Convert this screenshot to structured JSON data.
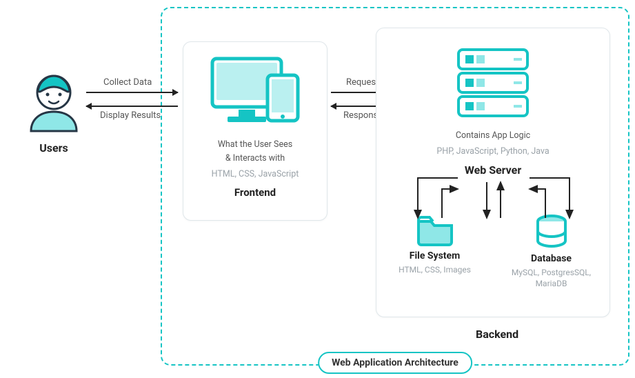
{
  "title_pill": "Web Application Architecture",
  "users": {
    "label": "Users"
  },
  "flows": {
    "collect": "Collect Data",
    "display": "Display Results",
    "request": "Request",
    "response": "Response"
  },
  "frontend": {
    "desc1": "What the User Sees",
    "desc2": "& Interacts with",
    "tech": "HTML, CSS, JavaScript",
    "title": "Frontend"
  },
  "backend": {
    "server_desc": "Contains App Logic",
    "server_tech": "PHP, JavaScript, Python, Java",
    "server_title": "Web Server",
    "fs_title": "File System",
    "fs_tech": "HTML, CSS, Images",
    "db_title": "Database",
    "db_tech": "MySQL, PostgresSQL, MariaDB",
    "label": "Backend"
  },
  "colors": {
    "accent": "#15c4c4",
    "accent_light": "#8fe7e7"
  }
}
